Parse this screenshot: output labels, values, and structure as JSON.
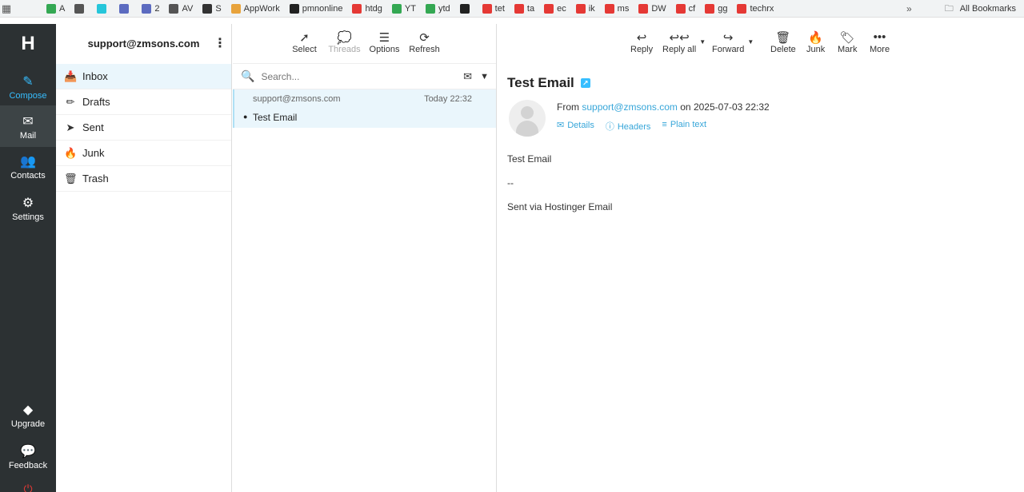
{
  "bookmarks": {
    "items": [
      {
        "label": "A",
        "color": "#34a853"
      },
      {
        "label": "",
        "color": "#555555"
      },
      {
        "label": "",
        "color": "#26c6da"
      },
      {
        "label": "",
        "color": "#5c6bc0"
      },
      {
        "label": "2",
        "color": "#5c6bc0"
      },
      {
        "label": "AV",
        "color": "#555555"
      },
      {
        "label": "S",
        "color": "#333333"
      },
      {
        "label": "AppWork",
        "color": "#e8a33c"
      },
      {
        "label": "pmnonline",
        "color": "#222222"
      },
      {
        "label": "htdg",
        "color": "#e53935"
      },
      {
        "label": "YT",
        "color": "#34a853"
      },
      {
        "label": "ytd",
        "color": "#34a853"
      },
      {
        "label": "",
        "color": "#222222"
      },
      {
        "label": "tet",
        "color": "#e53935"
      },
      {
        "label": "ta",
        "color": "#e53935"
      },
      {
        "label": "ec",
        "color": "#e53935"
      },
      {
        "label": "ik",
        "color": "#e53935"
      },
      {
        "label": "ms",
        "color": "#e53935"
      },
      {
        "label": "DW",
        "color": "#e53935"
      },
      {
        "label": "cf",
        "color": "#e53935"
      },
      {
        "label": "gg",
        "color": "#e53935"
      },
      {
        "label": "techrx",
        "color": "#e53935"
      }
    ],
    "more": "»",
    "all_bookmarks": "All Bookmarks"
  },
  "rail": {
    "compose": "Compose",
    "mail": "Mail",
    "contacts": "Contacts",
    "settings": "Settings",
    "upgrade": "Upgrade",
    "feedback": "Feedback"
  },
  "account": "support@zmsons.com",
  "folders": [
    "Inbox",
    "Drafts",
    "Sent",
    "Junk",
    "Trash"
  ],
  "list_toolbar": {
    "select": "Select",
    "threads": "Threads",
    "options": "Options",
    "refresh": "Refresh"
  },
  "search": {
    "placeholder": "Search..."
  },
  "messages": [
    {
      "from": "support@zmsons.com",
      "date": "Today 22:32",
      "subject": "Test Email"
    }
  ],
  "read_toolbar": {
    "reply": "Reply",
    "reply_all": "Reply all",
    "forward": "Forward",
    "delete": "Delete",
    "junk": "Junk",
    "mark": "Mark",
    "more": "More"
  },
  "email": {
    "subject": "Test Email",
    "from_label": "From",
    "from_address": "support@zmsons.com",
    "on_label": "on",
    "datetime": "2025-07-03 22:32",
    "links": {
      "details": "Details",
      "headers": "Headers",
      "plain": "Plain text"
    },
    "body": [
      "Test Email",
      "--",
      "Sent via Hostinger Email"
    ]
  },
  "colors": {
    "accent": "#37beff",
    "rail_bg": "#2c3133",
    "selection": "#eaf6fc"
  }
}
